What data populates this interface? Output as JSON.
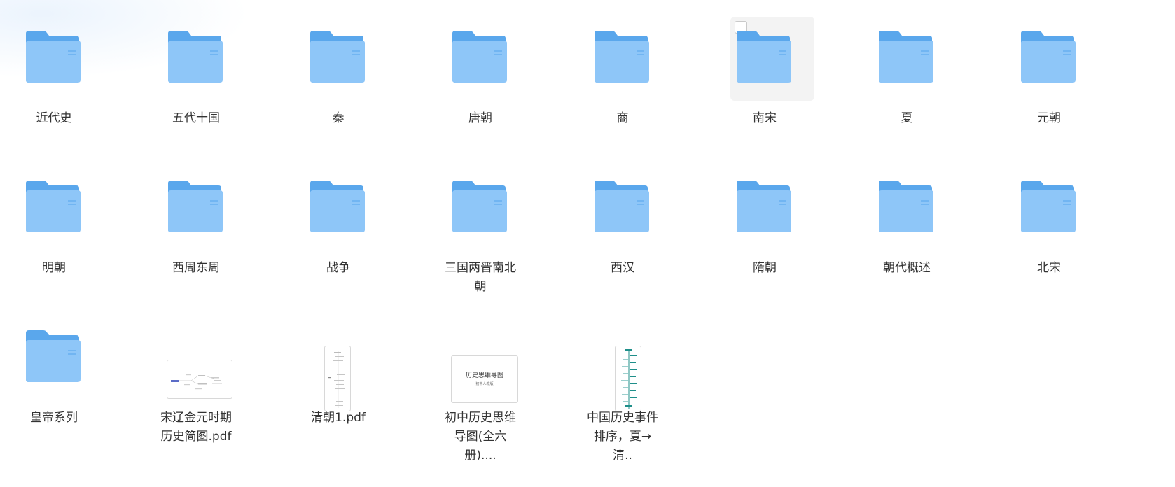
{
  "colors": {
    "folder_back": "#5aa7ec",
    "folder_front": "#8ec6f8",
    "accent_blue": "#5b6cc7",
    "accent_teal": "#1f8f8a"
  },
  "items": [
    {
      "type": "folder",
      "label": "近代史",
      "icon": "folder-icon"
    },
    {
      "type": "folder",
      "label": "五代十国",
      "icon": "folder-icon"
    },
    {
      "type": "folder",
      "label": "秦",
      "icon": "folder-icon"
    },
    {
      "type": "folder",
      "label": "唐朝",
      "icon": "folder-icon"
    },
    {
      "type": "folder",
      "label": "商",
      "icon": "folder-icon"
    },
    {
      "type": "folder",
      "label": "南宋",
      "icon": "folder-icon",
      "hover": true,
      "checked": false
    },
    {
      "type": "folder",
      "label": "夏",
      "icon": "folder-icon"
    },
    {
      "type": "folder",
      "label": "元朝",
      "icon": "folder-icon"
    },
    {
      "type": "folder",
      "label": "明朝",
      "icon": "folder-icon"
    },
    {
      "type": "folder",
      "label": "西周东周",
      "icon": "folder-icon"
    },
    {
      "type": "folder",
      "label": "战争",
      "icon": "folder-icon"
    },
    {
      "type": "folder",
      "label": "三国两晋南北朝",
      "icon": "folder-icon"
    },
    {
      "type": "folder",
      "label": "西汉",
      "icon": "folder-icon"
    },
    {
      "type": "folder",
      "label": "隋朝",
      "icon": "folder-icon"
    },
    {
      "type": "folder",
      "label": "朝代概述",
      "icon": "folder-icon"
    },
    {
      "type": "folder",
      "label": "北宋",
      "icon": "folder-icon"
    },
    {
      "type": "folder",
      "label": "皇帝系列",
      "icon": "folder-icon"
    },
    {
      "type": "file",
      "label": "宋辽金元时期历史简图.pdf",
      "icon": "pdf-thumbnail-mindmap-icon"
    },
    {
      "type": "file",
      "label": "清朝1.pdf",
      "icon": "pdf-thumbnail-portrait-icon"
    },
    {
      "type": "file",
      "label": "初中历史思维导图(全六册)....",
      "icon": "pdf-thumbnail-cover-icon",
      "thumb_title": "历史思维导图",
      "thumb_subtitle": "（初中人教版）"
    },
    {
      "type": "file",
      "label": "中国历史事件排序，夏→清..",
      "icon": "pdf-thumbnail-timeline-icon"
    }
  ]
}
